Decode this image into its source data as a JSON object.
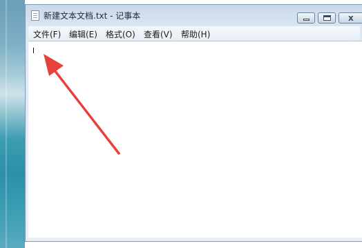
{
  "window": {
    "title": "新建文本文档.txt - 记事本",
    "close_glyph": "x"
  },
  "menu": [
    {
      "label": "文件(F)"
    },
    {
      "label": "编辑(E)"
    },
    {
      "label": "格式(O)"
    },
    {
      "label": "查看(V)"
    },
    {
      "label": "帮助(H)"
    }
  ],
  "editor": {
    "content": ""
  },
  "annotation": {
    "arrow_color": "#e8413c",
    "icon": "red-pointer-arrow"
  },
  "icons": {
    "app": "notepad-icon",
    "minimize": "minimize-icon",
    "maximize": "maximize-icon",
    "close": "close-icon"
  }
}
